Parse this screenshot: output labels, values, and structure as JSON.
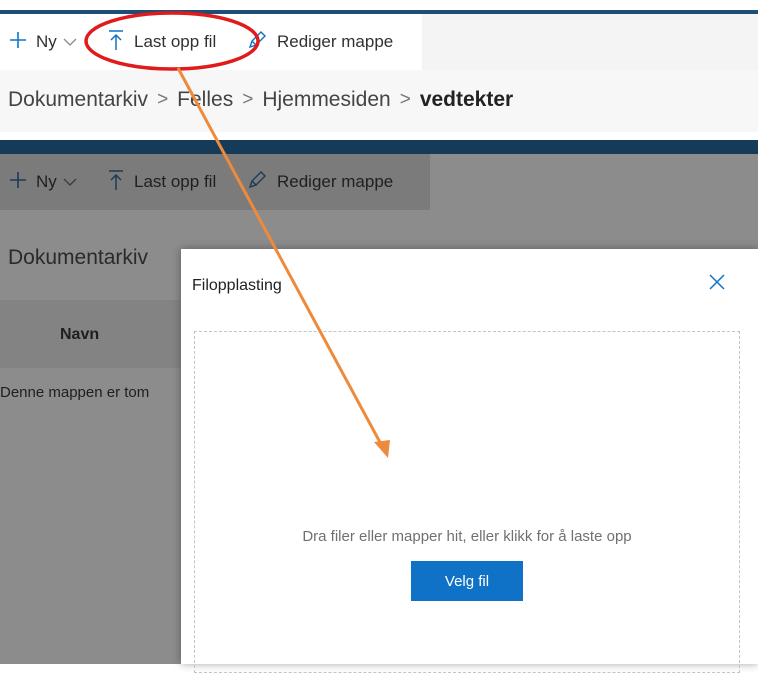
{
  "top": {
    "toolbar": {
      "new_label": "Ny",
      "upload_label": "Last opp fil",
      "edit_label": "Rediger mappe"
    },
    "breadcrumb": [
      "Dokumentarkiv",
      "Felles",
      "Hjemmesiden",
      "vedtekter"
    ]
  },
  "lower": {
    "toolbar": {
      "new_label": "Ny",
      "upload_label": "Last opp fil",
      "edit_label": "Rediger mappe"
    },
    "breadcrumb_first": "Dokumentarkiv",
    "column_header": "Navn",
    "empty_message": "Denne mappen er tom"
  },
  "dialog": {
    "title": "Filopplasting",
    "drop_text": "Dra filer eller mapper hit, eller klikk for å laste opp",
    "button_label": "Velg fil"
  },
  "colors": {
    "accent_blue": "#0f72c6",
    "header_bar": "#1d4f76",
    "annotation_circle": "#e01b1b",
    "annotation_arrow": "#ee8a3c"
  },
  "icons": [
    "plus-icon",
    "chevron-down-icon",
    "upload-icon",
    "pencil-icon",
    "close-icon"
  ]
}
